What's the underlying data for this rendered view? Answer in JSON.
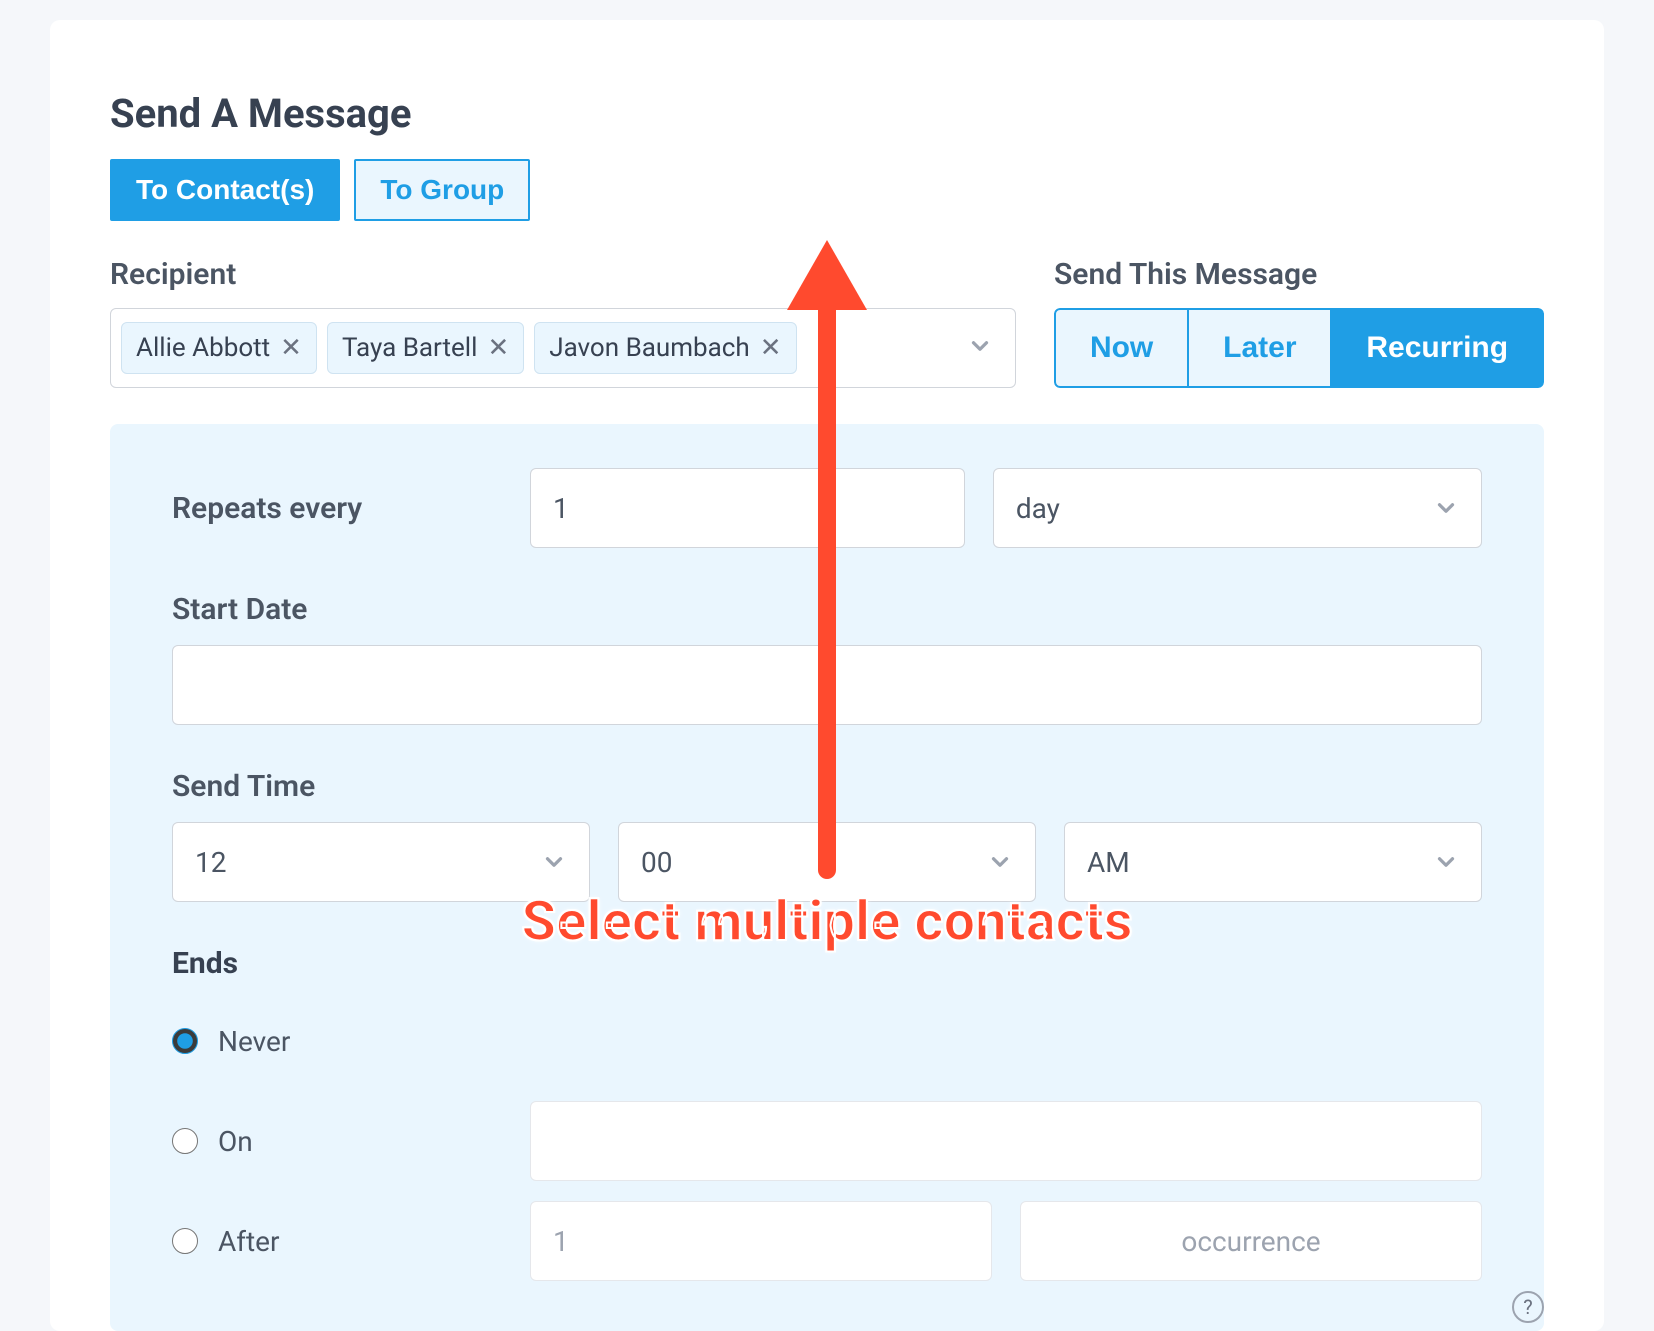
{
  "title": "Send A Message",
  "modeTabs": {
    "contacts": "To Contact(s)",
    "group": "To Group",
    "active": "contacts"
  },
  "recipient": {
    "label": "Recipient",
    "chips": [
      "Allie Abbott",
      "Taya Bartell",
      "Javon Baumbach"
    ]
  },
  "sendThis": {
    "label": "Send This Message",
    "now": "Now",
    "later": "Later",
    "recurring": "Recurring",
    "active": "recurring"
  },
  "recurring": {
    "repeats_label": "Repeats every",
    "repeats_value": "1",
    "repeats_unit": "day",
    "start_date_label": "Start Date",
    "start_date_value": "",
    "send_time_label": "Send Time",
    "hour": "12",
    "minute": "00",
    "ampm": "AM",
    "ends_label": "Ends",
    "ends_never": "Never",
    "ends_on": "On",
    "ends_on_value": "",
    "ends_after": "After",
    "ends_after_count": "1",
    "ends_after_unit": "occurrence",
    "selected": "never"
  },
  "annotation": "Select multiple contacts",
  "help": "?"
}
